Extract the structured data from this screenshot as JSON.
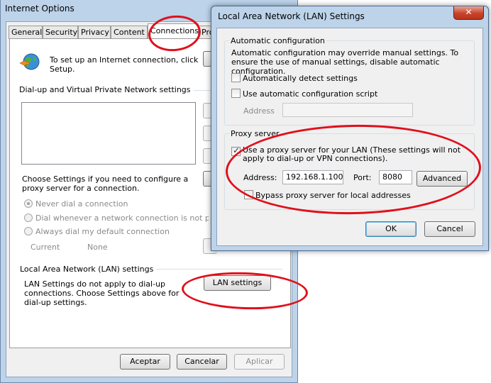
{
  "internet_options": {
    "title": "Internet Options",
    "tabs": [
      {
        "label": "General"
      },
      {
        "label": "Security"
      },
      {
        "label": "Privacy"
      },
      {
        "label": "Content"
      },
      {
        "label": "Connections"
      },
      {
        "label": "Pro"
      }
    ],
    "active_tab": "Connections",
    "setup_text": "To set up an Internet connection, click Setup.",
    "dialup_group_title": "Dial-up and Virtual Private Network settings",
    "proxy_hint": "Choose Settings if you need to configure a proxy server for a connection.",
    "radio_options": [
      {
        "label": "Never dial a connection",
        "selected": true
      },
      {
        "label": "Dial whenever a network connection is not present",
        "selected": false
      },
      {
        "label": "Always dial my default connection",
        "selected": false
      }
    ],
    "current_label": "Current",
    "current_value": "None",
    "lan_group_title": "Local Area Network (LAN) settings",
    "lan_note": "LAN Settings do not apply to dial-up connections. Choose Settings above for dial-up settings.",
    "lan_settings_button": "LAN settings",
    "footer_buttons": {
      "ok": "Aceptar",
      "cancel": "Cancelar",
      "apply": "Aplicar"
    }
  },
  "lan_dialog": {
    "title": "Local Area Network (LAN) Settings",
    "close_glyph": "✕",
    "auto_config": {
      "legend": "Automatic configuration",
      "description": "Automatic configuration may override manual settings.  To ensure the use of manual settings, disable automatic configuration.",
      "auto_detect_label": "Automatically detect settings",
      "auto_detect_checked": false,
      "use_script_label": "Use automatic configuration script",
      "use_script_checked": false,
      "address_label": "Address",
      "address_value": ""
    },
    "proxy": {
      "legend": "Proxy server",
      "use_proxy_label": "Use a proxy server for your LAN (These settings will not apply to dial-up or VPN connections).",
      "use_proxy_checked": true,
      "address_label": "Address:",
      "address_value": "192.168.1.100",
      "port_label": "Port:",
      "port_value": "8080",
      "advanced_button": "Advanced",
      "bypass_label": "Bypass proxy server for local addresses",
      "bypass_checked": false
    },
    "ok_button": "OK",
    "cancel_button": "Cancel"
  },
  "annotation_color": "#e0101b"
}
